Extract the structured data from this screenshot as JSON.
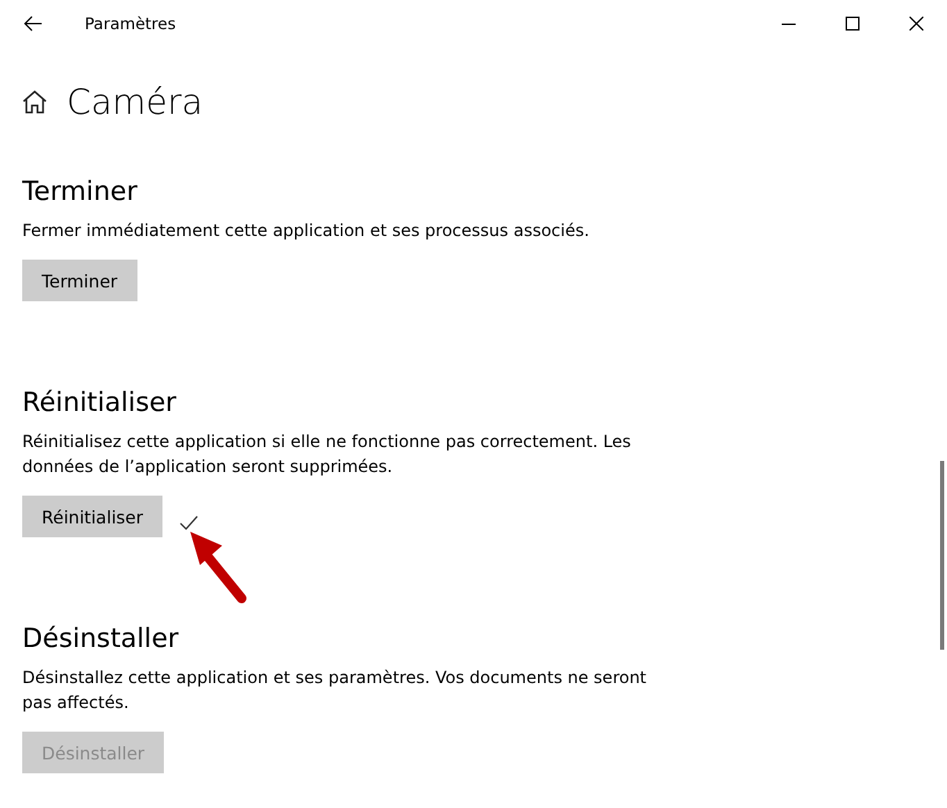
{
  "window": {
    "title": "Paramètres"
  },
  "page": {
    "title": "Caméra"
  },
  "sections": [
    {
      "heading": "Terminer",
      "description": "Fermer immédiatement cette application et ses processus associés.",
      "button": {
        "label": "Terminer",
        "disabled": false
      },
      "done": false
    },
    {
      "heading": "Réinitialiser",
      "description": "Réinitialisez cette application si elle ne fonctionne pas correctement. Les données de l’application seront supprimées.",
      "button": {
        "label": "Réinitialiser",
        "disabled": false
      },
      "done": true
    },
    {
      "heading": "Désinstaller",
      "description": "Désinstallez cette application et ses paramètres. Vos documents ne seront pas affectés.",
      "button": {
        "label": "Désinstaller",
        "disabled": true
      },
      "done": false
    }
  ]
}
